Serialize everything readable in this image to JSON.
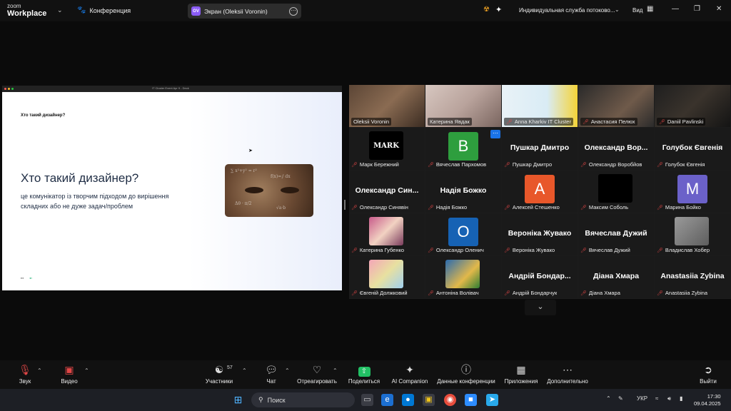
{
  "app": {
    "logo_top": "zoom",
    "logo_bottom": "Workplace",
    "meeting_label": "Конференция"
  },
  "share": {
    "avatar_initials": "OV",
    "title": "Экран (Oleksii Voronin)"
  },
  "topbar": {
    "service": "Индивидуальная служба потоково...",
    "view_label": "Вид"
  },
  "slide": {
    "window_title": "IT Cluster Event Apr 9 - Deck",
    "small_title": "Хто такий дизайнер?",
    "title": "Хто такий дизайнер?",
    "subtitle": "це комунікатор із творчим підходом до вирішення складних або не дуже задач/проблем"
  },
  "participants": [
    {
      "name": "Oleksii Voronin",
      "kind": "video",
      "muted": false
    },
    {
      "name": "Катерина Явдак",
      "kind": "video",
      "muted": false,
      "active": true
    },
    {
      "name": "Anna Kharkiv IT Cluster",
      "kind": "video",
      "muted": true
    },
    {
      "name": "Анастасия Пелюх",
      "kind": "video",
      "muted": true
    },
    {
      "name": "Daniil Pavlinski",
      "kind": "video",
      "muted": true
    },
    {
      "name": "Марк Бережний",
      "kind": "avatar-mark",
      "muted": true
    },
    {
      "name": "Вячеслав Пархомов",
      "kind": "letter",
      "letter": "В",
      "color": "#2e9e3e",
      "muted": true
    },
    {
      "name": "Пушкар Дмитро",
      "display": "Пушкар Дмитро",
      "kind": "name",
      "muted": true
    },
    {
      "name": "Олександр Воробйов",
      "display": "Олександр Вор...",
      "kind": "name",
      "muted": true
    },
    {
      "name": "Голубок Євгенія",
      "display": "Голубок Євгенія",
      "kind": "name",
      "muted": true
    },
    {
      "name": "Олександр Синявін",
      "display": "Олександр Син...",
      "kind": "name",
      "muted": true
    },
    {
      "name": "Надія Божко",
      "display": "Надія Божко",
      "kind": "name",
      "muted": true
    },
    {
      "name": "Алексей Стешенко",
      "kind": "letter",
      "letter": "А",
      "color": "#e8572a",
      "muted": true
    },
    {
      "name": "Максим Соболь",
      "kind": "black",
      "muted": true
    },
    {
      "name": "Марина Бойко",
      "kind": "letter",
      "letter": "М",
      "color": "#6b61c9",
      "muted": true
    },
    {
      "name": "Катерина Губенко",
      "kind": "avatar-anime",
      "muted": true
    },
    {
      "name": "Олександр Оленич",
      "kind": "letter",
      "letter": "О",
      "color": "#1662b4",
      "muted": true
    },
    {
      "name": "Вероніка Жувако",
      "display": "Вероніка Жувако",
      "kind": "name",
      "muted": true
    },
    {
      "name": "Вячеслав Дужий",
      "display": "Вячеслав Дужий",
      "kind": "name",
      "muted": true
    },
    {
      "name": "Владислав Хобер",
      "kind": "avatar-gray",
      "muted": true
    },
    {
      "name": "Євгеній Должковий",
      "kind": "avatar-cartoon",
      "muted": true
    },
    {
      "name": "Антоніна Волівач",
      "kind": "avatar-portrait",
      "muted": true
    },
    {
      "name": "Андрій Бондарчук",
      "display": "Андрій Бондар...",
      "kind": "name",
      "muted": true
    },
    {
      "name": "Діана Хмара",
      "display": "Діана Хмара",
      "kind": "name",
      "muted": true
    },
    {
      "name": "Anastasiia Zybina",
      "display": "Anastasiia Zybina",
      "kind": "name",
      "muted": true
    }
  ],
  "toolbar": {
    "audio": "Звук",
    "video": "Видео",
    "participants": "Участники",
    "participants_count": "57",
    "chat": "Чат",
    "react": "Отреагировать",
    "share": "Поделиться",
    "ai": "AI Companion",
    "info": "Данные конференции",
    "apps": "Приложения",
    "more": "Дополнительно",
    "leave": "Выйти"
  },
  "taskbar": {
    "search": "Поиск",
    "lang": "УКР",
    "time": "17:30",
    "date": "09.04.2025"
  }
}
